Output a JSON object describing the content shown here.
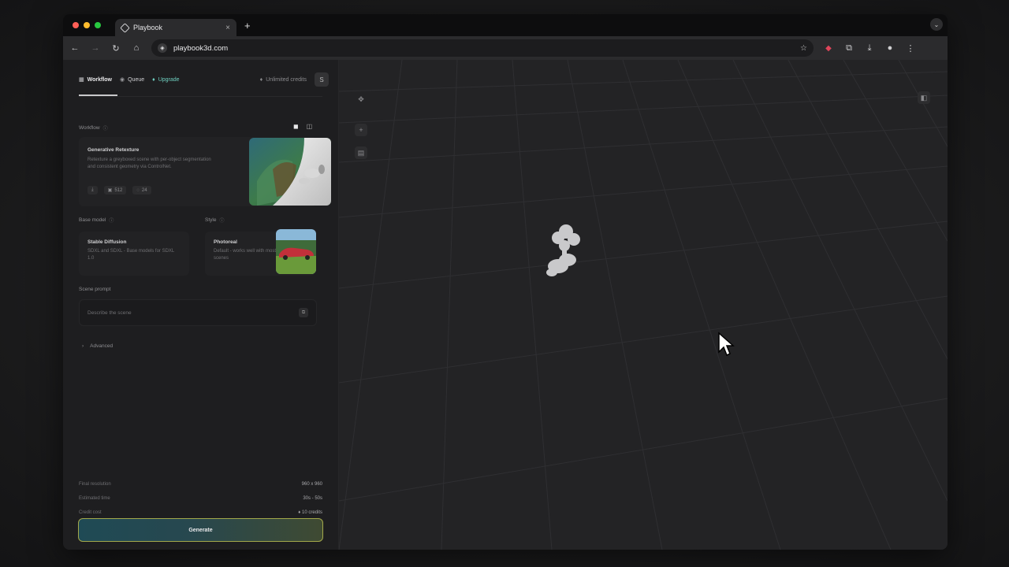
{
  "browser": {
    "tab_title": "Playbook",
    "tab_close": "×",
    "new_tab": "+",
    "url": "playbook3d.com"
  },
  "sidebar": {
    "tabs": [
      {
        "label": "Workflow",
        "icon": "grid-icon"
      },
      {
        "label": "Queue",
        "icon": "queue-icon"
      },
      {
        "label": "Upgrade",
        "icon": "upgrade-icon"
      }
    ],
    "credits": "Unlimited credits",
    "user_initial": "S",
    "workflow_section": "Workflow",
    "workflow_card": {
      "title": "Generative Retexture",
      "description": "Retexture a greyboxed scene with per-object segmentation and consistent geometry via ControlNet.",
      "badge_count": "512",
      "steps": "24"
    },
    "base_model_section": "Base model",
    "style_section": "Style",
    "base_model_card": {
      "title": "Stable Diffusion",
      "description": "SDXL and SDXL - Base models for SDXL 1.0"
    },
    "style_card": {
      "title": "Photoreal",
      "description": "Default - works well with most scenes"
    },
    "prompt_section": "Scene prompt",
    "prompt_placeholder": "Describe the scene",
    "advanced_label": "Advanced",
    "stats": [
      {
        "label": "Final resolution",
        "value": "960 x 960"
      },
      {
        "label": "Estimated time",
        "value": "30s - 50s"
      },
      {
        "label": "Credit cost",
        "value": "10 credits"
      }
    ],
    "generate_label": "Generate"
  },
  "colors": {
    "accent_teal": "#6fd0c0",
    "generate_border": "#a3a84a",
    "background": "#1e1e20"
  }
}
